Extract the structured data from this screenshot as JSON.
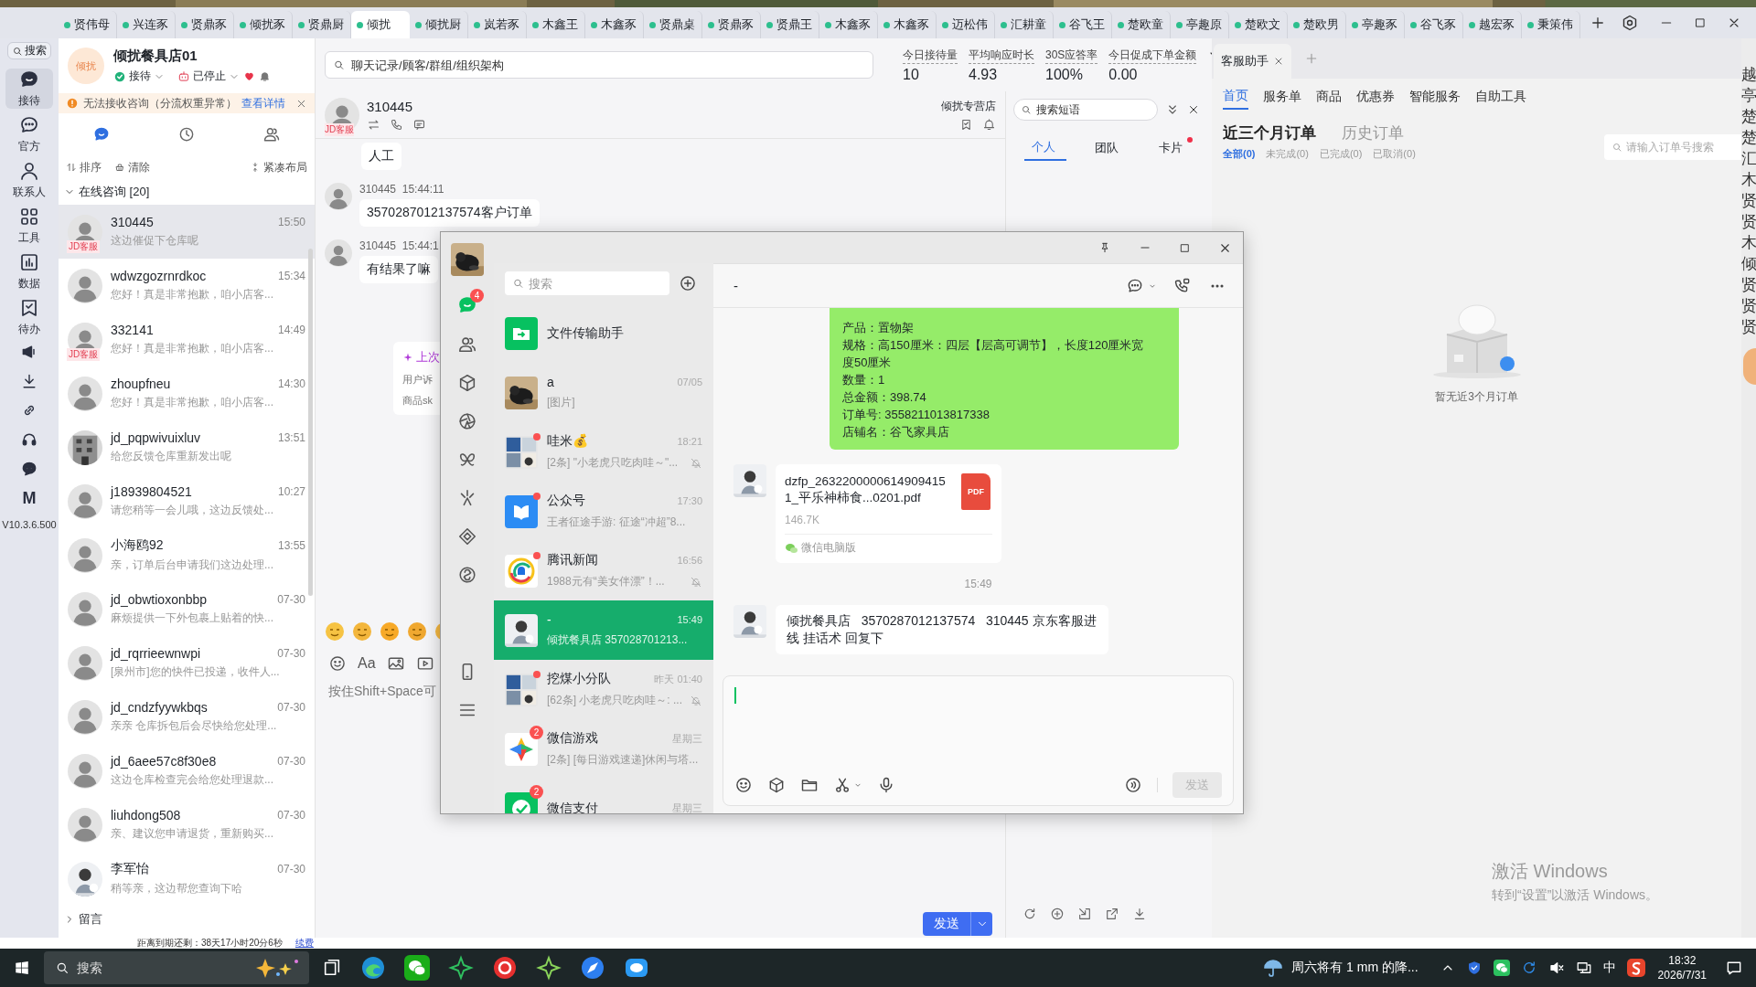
{
  "top_tabs": [
    {
      "label": "贤伟母",
      "selected": false
    },
    {
      "label": "兴连豕",
      "selected": false
    },
    {
      "label": "贤鼎豕",
      "selected": false
    },
    {
      "label": "倾扰豕",
      "selected": false
    },
    {
      "label": "贤鼎厨",
      "selected": false
    },
    {
      "label": "倾扰",
      "selected": true
    },
    {
      "label": "倾扰厨",
      "selected": false
    },
    {
      "label": "岚若豕",
      "selected": false
    },
    {
      "label": "木鑫王",
      "selected": false
    },
    {
      "label": "木鑫豕",
      "selected": false
    },
    {
      "label": "贤鼎桌",
      "selected": false
    },
    {
      "label": "贤鼎豕",
      "selected": false
    },
    {
      "label": "贤鼎王",
      "selected": false
    },
    {
      "label": "木鑫豕",
      "selected": false
    },
    {
      "label": "木鑫豕",
      "selected": false
    },
    {
      "label": "迈松伟",
      "selected": false
    },
    {
      "label": "汇耕童",
      "selected": false
    },
    {
      "label": "谷飞王",
      "selected": false
    },
    {
      "label": "楚欧童",
      "selected": false
    },
    {
      "label": "亭趣原",
      "selected": false
    },
    {
      "label": "楚欧文",
      "selected": false
    },
    {
      "label": "楚欧男",
      "selected": false
    },
    {
      "label": "亭趣豕",
      "selected": false
    },
    {
      "label": "谷飞豕",
      "selected": false
    },
    {
      "label": "越宏豕",
      "selected": false
    },
    {
      "label": "秉策伟",
      "selected": false
    }
  ],
  "nav_rail": {
    "search": "搜索",
    "items": [
      {
        "kind": "reception",
        "label": "接待",
        "selected": true
      },
      {
        "kind": "official",
        "label": "官方",
        "selected": false
      },
      {
        "kind": "contacts",
        "label": "联系人",
        "selected": false
      },
      {
        "kind": "tools",
        "label": "工具",
        "selected": false
      },
      {
        "kind": "data",
        "label": "数据",
        "selected": false
      },
      {
        "kind": "todo",
        "label": "待办",
        "selected": false
      }
    ],
    "logo_text": "M",
    "version": "V10.3.6.500"
  },
  "shop": {
    "avatar_text": "倾扰",
    "name": "倾扰餐具店01",
    "status": "接待",
    "robot_status": "已停止"
  },
  "alert": {
    "text": "无法接收咨询（分流权重异常）",
    "link": "查看详情"
  },
  "list_tabs": [
    {
      "kind": "chat",
      "selected": true
    },
    {
      "kind": "history",
      "selected": false
    },
    {
      "kind": "team",
      "selected": false
    }
  ],
  "list_tools": [
    "排序",
    "清除",
    "紧凑布局"
  ],
  "group": {
    "label": "在线咨询 [20]",
    "expanded": true
  },
  "conversations": [
    {
      "name": "310445",
      "time": "15:50",
      "preview": "这边催促下仓库呢",
      "kind": "mascot",
      "badge": "JD客服",
      "selected": true
    },
    {
      "name": "wdwzgozrnrdkoc",
      "time": "15:34",
      "preview": "您好！真是非常抱歉，咱小店客...",
      "kind": "mascot",
      "selected": false
    },
    {
      "name": "332141",
      "time": "14:49",
      "preview": "您好！真是非常抱歉，咱小店客...",
      "kind": "mascot",
      "badge": "JD客服",
      "selected": false
    },
    {
      "name": "zhoupfneu",
      "time": "14:30",
      "preview": "您好！真是非常抱歉，咱小店客...",
      "kind": "mascot",
      "selected": false
    },
    {
      "name": "jd_pqpwivuixluv",
      "time": "13:51",
      "preview": "给您反馈仓库重新发出呢",
      "selected": false
    },
    {
      "name": "j18939804521",
      "time": "10:27",
      "preview": "请您稍等一会儿哦，这边反馈处...",
      "kind": "mascot",
      "selected": false
    },
    {
      "name": "小海鸥92",
      "time": "13:55",
      "preview": "亲，订单后台申请我们这边处理...",
      "kind": "mascot",
      "selected": false
    },
    {
      "name": "jd_obwtioxonbbp",
      "time": "07-30",
      "preview": "麻烦提供一下外包裹上贴着的快...",
      "kind": "mascot",
      "selected": false
    },
    {
      "name": "jd_rqrrieewnwpi",
      "time": "07-30",
      "preview": "[泉州市]您的快件已投递，收件人...",
      "kind": "mascot",
      "selected": false
    },
    {
      "name": "jd_cndzfyywkbqs",
      "time": "07-30",
      "preview": "亲亲 仓库拆包后会尽快给您处理...",
      "kind": "mascot",
      "selected": false
    },
    {
      "name": "jd_6aee57c8f30e8",
      "time": "07-30",
      "preview": "这边仓库检查完会给您处理退款...",
      "kind": "mascot",
      "selected": false
    },
    {
      "name": "liuhdong508",
      "time": "07-30",
      "preview": "亲、建议您申请退货，重新购买...",
      "kind": "mascot",
      "selected": false
    },
    {
      "name": "李军怡",
      "time": "07-30",
      "preview": "稍等亲，这边帮您查询下哈",
      "kind": "person",
      "selected": false
    }
  ],
  "footer_group": {
    "label": "留言",
    "expanded": false
  },
  "global_search": {
    "placeholder": "聊天记录/顾客/群组/组织架构"
  },
  "stats": [
    {
      "label": "今日接待量",
      "value": "10"
    },
    {
      "label": "平均响应时长",
      "value": "4.93"
    },
    {
      "label": "30S应答率",
      "value": "100%"
    },
    {
      "label": "今日促成下单金额",
      "value": "0.00"
    }
  ],
  "chat": {
    "customer": "310445",
    "badge": "JD客服",
    "shop": "倾扰专营店",
    "messages": [
      {
        "kind": "continued",
        "text": "人工"
      },
      {
        "kind": "message",
        "sender": "310445",
        "time": "15:44:11",
        "text": "3570287012137574客户订单"
      },
      {
        "kind": "message",
        "sender": "310445",
        "time": "15:44:1",
        "text": "有结果了嘛"
      }
    ],
    "card": {
      "title": "上次",
      "lines": [
        "用户诉",
        "商品sk"
      ]
    },
    "font_button": "Aa",
    "input_hint": "按住Shift+Space可",
    "send": "发送"
  },
  "expiry_bar": {
    "text": "距离到期还剩：38天17小时20分6秒",
    "link": "续费"
  },
  "phrases": {
    "placeholder": "搜索短语",
    "tabs": [
      {
        "label": "个人",
        "selected": true,
        "dot": false
      },
      {
        "label": "团队",
        "selected": false,
        "dot": false
      },
      {
        "label": "卡片",
        "selected": false,
        "dot": true
      }
    ]
  },
  "assistant": {
    "tab": "客服助手",
    "nav": [
      {
        "label": "首页",
        "selected": true
      },
      {
        "label": "服务单",
        "selected": false
      },
      {
        "label": "商品",
        "selected": false
      },
      {
        "label": "优惠券",
        "selected": false
      },
      {
        "label": "智能服务",
        "selected": false
      },
      {
        "label": "自助工具",
        "selected": false
      }
    ],
    "order_tabs": [
      {
        "label": "近三个月订单",
        "selected": true
      },
      {
        "label": "历史订单",
        "selected": false
      }
    ],
    "filters": [
      {
        "label": "全部(0)",
        "selected": true
      },
      {
        "label": "未完成(0)",
        "selected": false
      },
      {
        "label": "已完成(0)",
        "selected": false
      },
      {
        "label": "已取消(0)",
        "selected": false
      }
    ],
    "order_search": {
      "placeholder": "请输入订单号搜索"
    },
    "empty_text": "暂无近3个月订单"
  },
  "edge_strip": [
    "越",
    "亭",
    "楚",
    "楚",
    "汇",
    "木",
    "贤",
    "贤",
    "木",
    "倾",
    "贤",
    "贤",
    "贤"
  ],
  "windows_notice": {
    "title": "激活 Windows",
    "text": "转到“设置”以激活 Windows。"
  },
  "wechat": {
    "chat_badge": "4",
    "search": {
      "placeholder": "搜索"
    },
    "items": [
      {
        "name": "文件传输助手",
        "kind": "file",
        "selected": false,
        "unread_dot": false,
        "muted": false
      },
      {
        "name": "a",
        "time": "07/05",
        "preview": "[图片]",
        "selected": false,
        "unread_dot": false,
        "muted": false
      },
      {
        "name": "哇米💰",
        "time": "18:21",
        "preview": "[2条] \"小老虎只吃肉哇～\"...",
        "kind": "group",
        "selected": false,
        "unread_dot": true,
        "muted": true
      },
      {
        "name": "公众号",
        "time": "17:30",
        "preview": "王者征途手游: 征途“冲超”8...",
        "kind": "official",
        "selected": false,
        "unread_dot": true,
        "muted": false
      },
      {
        "name": "腾讯新闻",
        "time": "16:56",
        "preview": "1988元有“美女伴漂”！...",
        "kind": "news",
        "selected": false,
        "unread_dot": true,
        "muted": true
      },
      {
        "name": "-",
        "time": "15:49",
        "preview": "倾扰餐具店   357028701213...",
        "kind": "person",
        "selected": true,
        "unread_dot": false,
        "muted": false
      },
      {
        "name": "挖煤小分队",
        "time": "昨天 01:40",
        "preview": "[62条] 小老虎只吃肉哇～: ...",
        "kind": "group",
        "selected": false,
        "unread_dot": true,
        "muted": true
      },
      {
        "name": "微信游戏",
        "time": "星期三",
        "preview": "[2条] [每日游戏速递]休闲与塔...",
        "kind": "game",
        "badge": "2",
        "selected": false,
        "unread_dot": false,
        "muted": false
      },
      {
        "name": "微信支付",
        "time": "星期三",
        "kind": "pay",
        "badge": "2",
        "selected": false,
        "unread_dot": false,
        "muted": false
      }
    ],
    "chat_title": "-",
    "order_lines": [
      "产品：置物架",
      "规格：高150厘米：四层【层高可调节】，长度120厘米宽度50厘米",
      "数量：1",
      "总金额：398.74",
      "订单号: 3558211013817338",
      "店铺名：谷飞家具店"
    ],
    "file": {
      "name": "dzfp_26322000006149094151_平乐神柿食...0201.pdf",
      "type": "PDF",
      "size": "146.7K",
      "source": "微信电脑版"
    },
    "time_divider": "15:49",
    "last_message": "倾扰餐具店   3570287012137574   310445 京东客服进线 挂话术 回复下",
    "send": {
      "label": "发送",
      "disabled": true
    }
  },
  "taskbar": {
    "search": {
      "placeholder": "搜索"
    },
    "weather": "周六将有 1 mm 的降...",
    "ime": "中",
    "time": "18:32",
    "date": "2026/7/31"
  }
}
